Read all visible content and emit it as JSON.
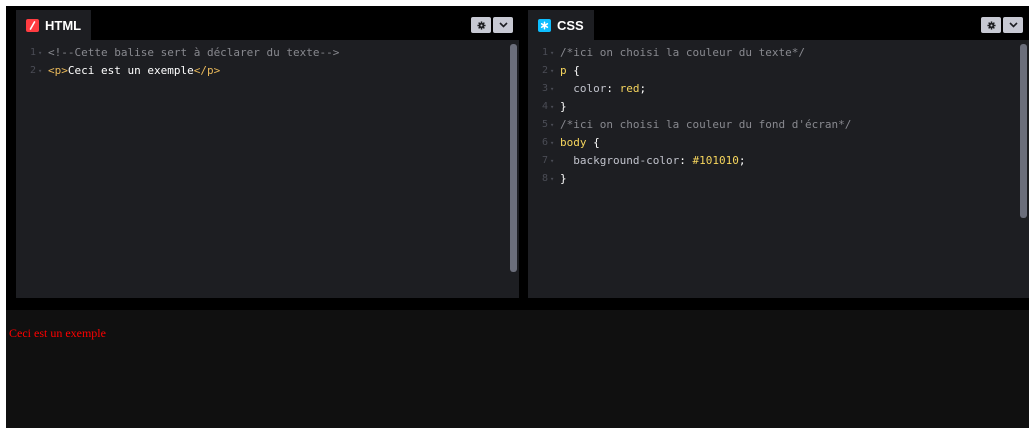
{
  "html_panel": {
    "tab_label": "HTML",
    "icon": "html-logo-icon",
    "accent": "#ff3c41",
    "lines": [
      {
        "n": "1",
        "parts": [
          {
            "t": "<!--Cette balise sert à déclarer du texte-->",
            "c": "c-comment"
          }
        ]
      },
      {
        "n": "2",
        "parts": [
          {
            "t": "<p>",
            "c": "c-tag"
          },
          {
            "t": "Ceci est un exemple",
            "c": "c-plain"
          },
          {
            "t": "</p>",
            "c": "c-tag"
          }
        ]
      }
    ]
  },
  "css_panel": {
    "tab_label": "CSS",
    "icon": "css-logo-icon",
    "accent": "#0ebeff",
    "lines": [
      {
        "n": "1",
        "parts": [
          {
            "t": "/*ici on choisi la couleur du texte*/",
            "c": "c-comment"
          }
        ]
      },
      {
        "n": "2",
        "parts": [
          {
            "t": "p",
            "c": "c-sel"
          },
          {
            "t": " {",
            "c": "c-plain"
          }
        ]
      },
      {
        "n": "3",
        "parts": [
          {
            "t": "  color",
            "c": "c-prop"
          },
          {
            "t": ": ",
            "c": "c-plain"
          },
          {
            "t": "red",
            "c": "c-val"
          },
          {
            "t": ";",
            "c": "c-plain"
          }
        ]
      },
      {
        "n": "4",
        "parts": [
          {
            "t": "}",
            "c": "c-plain"
          }
        ]
      },
      {
        "n": "5",
        "parts": [
          {
            "t": "/*ici on choisi la couleur du fond d'écran*/",
            "c": "c-comment"
          }
        ]
      },
      {
        "n": "6",
        "parts": [
          {
            "t": "body",
            "c": "c-sel"
          },
          {
            "t": " {",
            "c": "c-plain"
          }
        ]
      },
      {
        "n": "7",
        "parts": [
          {
            "t": "  background-color",
            "c": "c-prop"
          },
          {
            "t": ": ",
            "c": "c-plain"
          },
          {
            "t": "#101010",
            "c": "c-val"
          },
          {
            "t": ";",
            "c": "c-plain"
          }
        ]
      },
      {
        "n": "8",
        "parts": [
          {
            "t": "}",
            "c": "c-plain"
          }
        ]
      }
    ]
  },
  "preview": {
    "text": "Ceci est un exemple",
    "text_color": "#ff0000",
    "background": "#101010"
  },
  "header_buttons": {
    "settings_icon": "gear-icon",
    "dropdown_icon": "chevron-down-icon"
  }
}
